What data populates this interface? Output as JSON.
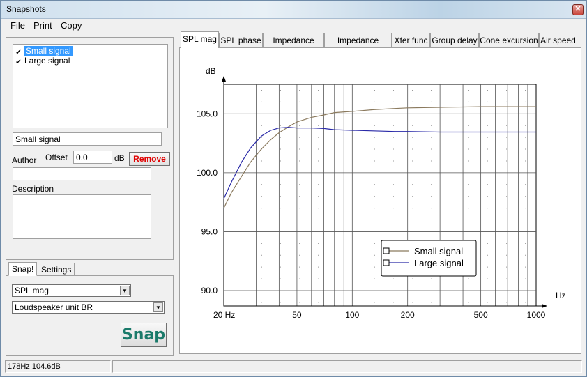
{
  "window": {
    "title": "Snapshots",
    "close_glyph": "✕"
  },
  "menu": {
    "file": "File",
    "print": "Print",
    "copy": "Copy"
  },
  "snapshots": [
    {
      "label": "Small signal",
      "checked": true,
      "selected": true
    },
    {
      "label": "Large signal",
      "checked": true,
      "selected": false
    }
  ],
  "details": {
    "name_value": "Small signal",
    "author_label": "Author",
    "offset_label": "Offset",
    "offset_value": "0.0",
    "offset_unit": "dB",
    "remove_label": "Remove",
    "author_value": "",
    "description_label": "Description",
    "description_value": ""
  },
  "bottom_tabs": {
    "snap": "Snap!",
    "settings": "Settings"
  },
  "combos": {
    "plot_type": "SPL mag",
    "unit": "Loudspeaker unit BR"
  },
  "snap_button": "Snap",
  "tabs": [
    "SPL mag",
    "SPL phase",
    "Impedance mag",
    "Impedance phase",
    "Xfer func",
    "Group delay",
    "Cone excursion",
    "Air speed"
  ],
  "active_tab": "SPL mag",
  "status": {
    "readout": "178Hz 104.6dB",
    "secondary": ""
  },
  "colors": {
    "small_signal": "#8b7a5e",
    "large_signal": "#2a2aa8",
    "remove_text": "#e00000",
    "snap_text": "#1a7a6a",
    "selection": "#3399ff"
  },
  "chart_data": {
    "type": "line",
    "ylabel": "dB",
    "xlabel": "Hz",
    "xscale": "log",
    "xlim": [
      20,
      1000
    ],
    "ylim": [
      88.7,
      107.5
    ],
    "x_tick_labels": [
      "20 Hz",
      "50",
      "100",
      "200",
      "500",
      "1000"
    ],
    "x_tick_values": [
      20,
      50,
      100,
      200,
      500,
      1000
    ],
    "y_tick_labels": [
      "105.0",
      "100.0",
      "95.0",
      "90.0"
    ],
    "y_tick_values": [
      105,
      100,
      95,
      90
    ],
    "grid": true,
    "legend_position": "bottom-center",
    "series": [
      {
        "name": "Small signal",
        "color": "#8b7a5e",
        "x": [
          20,
          22,
          25,
          28,
          32,
          36,
          40,
          45,
          50,
          60,
          70,
          80,
          100,
          130,
          170,
          200,
          300,
          500,
          1000
        ],
        "y": [
          97.0,
          98.3,
          99.7,
          100.9,
          102.0,
          102.8,
          103.4,
          103.9,
          104.3,
          104.7,
          104.9,
          105.1,
          105.2,
          105.35,
          105.45,
          105.5,
          105.55,
          105.6,
          105.6
        ]
      },
      {
        "name": "Large signal",
        "color": "#2a2aa8",
        "x": [
          20,
          22,
          25,
          28,
          32,
          36,
          40,
          45,
          50,
          60,
          70,
          80,
          100,
          130,
          170,
          200,
          300,
          500,
          1000
        ],
        "y": [
          97.8,
          99.2,
          100.9,
          102.1,
          103.1,
          103.6,
          103.8,
          103.85,
          103.8,
          103.8,
          103.75,
          103.65,
          103.6,
          103.55,
          103.5,
          103.5,
          103.45,
          103.45,
          103.45
        ]
      }
    ]
  }
}
